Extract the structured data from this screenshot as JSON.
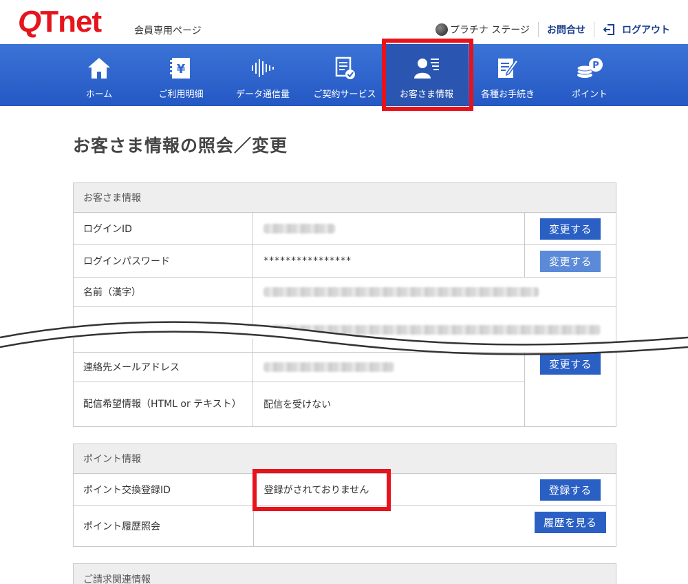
{
  "header": {
    "logo_q": "Q",
    "logo_net": "Tnet",
    "logo_sub": "会員専用ページ",
    "stage": "プラチナ ステージ",
    "contact": "お問合せ",
    "logout": "ログアウト"
  },
  "nav": [
    {
      "label": "ホーム",
      "icon": "home-icon"
    },
    {
      "label": "ご利用明細",
      "icon": "bill-icon"
    },
    {
      "label": "データ通信量",
      "icon": "waveform-icon"
    },
    {
      "label": "ご契約サービス",
      "icon": "contract-icon"
    },
    {
      "label": "お客さま情報",
      "icon": "user-info-icon"
    },
    {
      "label": "各種お手続き",
      "icon": "edit-doc-icon"
    },
    {
      "label": "ポイント",
      "icon": "coins-icon"
    }
  ],
  "page_title": "お客さま情報の照会／変更",
  "customer": {
    "section_title": "お客さま情報",
    "rows": [
      {
        "label": "ログインID",
        "button": "変更する"
      },
      {
        "label": "ログインパスワード",
        "value": "****************",
        "button": "変更する"
      },
      {
        "label": "名前（漢字）"
      },
      {
        "label": "連絡先メールアドレス",
        "button": "変更する"
      },
      {
        "label": "配信希望情報（HTML or テキスト）",
        "value": "配信を受けない"
      }
    ]
  },
  "points": {
    "section_title": "ポイント情報",
    "rows": [
      {
        "label": "ポイント交換登録ID",
        "value": "登録がされておりません",
        "button": "登録する"
      },
      {
        "label": "ポイント履歴照会",
        "button": "履歴を見る"
      }
    ]
  },
  "billing": {
    "section_title": "ご請求関連情報"
  },
  "colors": {
    "brand_red": "#e5141d",
    "nav_blue": "#2f66d0",
    "button_blue": "#2a5fc4",
    "highlight_red": "#e8121b"
  }
}
